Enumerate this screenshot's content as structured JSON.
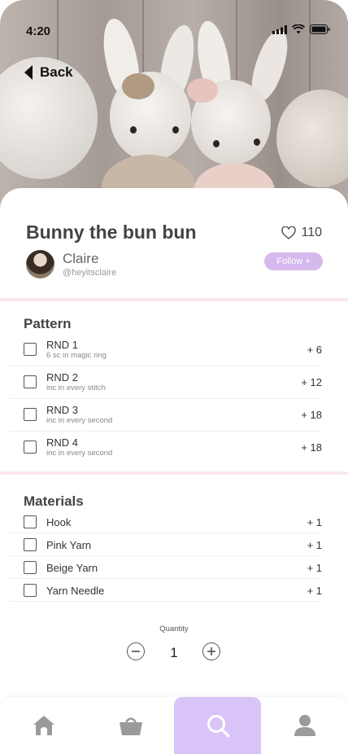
{
  "status_bar": {
    "time": "4:20"
  },
  "header": {
    "back_label": "Back"
  },
  "pattern_info": {
    "title": "Bunny the bun bun",
    "likes": "110",
    "author": {
      "name": "Claire",
      "handle": "@heyitsclaire"
    },
    "follow_label": "Follow +"
  },
  "pattern": {
    "heading": "Pattern",
    "rows": [
      {
        "label": "RND 1",
        "sub": "6 sc in magic ring",
        "count": "+ 6"
      },
      {
        "label": "RND 2",
        "sub": "inc in every stitch",
        "count": "+ 12"
      },
      {
        "label": "RND 3",
        "sub": "inc in every second",
        "count": "+ 18"
      },
      {
        "label": "RND 4",
        "sub": "inc in every second",
        "count": "+ 18"
      }
    ]
  },
  "materials": {
    "heading": "Materials",
    "rows": [
      {
        "label": "Hook",
        "count": "+ 1"
      },
      {
        "label": "Pink Yarn",
        "count": "+ 1"
      },
      {
        "label": "Beige Yarn",
        "count": "+ 1"
      },
      {
        "label": "Yarn Needle",
        "count": "+ 1"
      }
    ]
  },
  "quantity": {
    "label": "Quantity",
    "value": "1"
  },
  "bottom_nav": {
    "items": [
      {
        "icon": "home-icon",
        "active": false
      },
      {
        "icon": "basket-icon",
        "active": false
      },
      {
        "icon": "search-icon",
        "active": true
      },
      {
        "icon": "profile-icon",
        "active": false
      }
    ]
  },
  "colors": {
    "accent": "#d9c4f7",
    "follow_bg": "#d5b8ed",
    "divider": "#fbe7ee"
  }
}
